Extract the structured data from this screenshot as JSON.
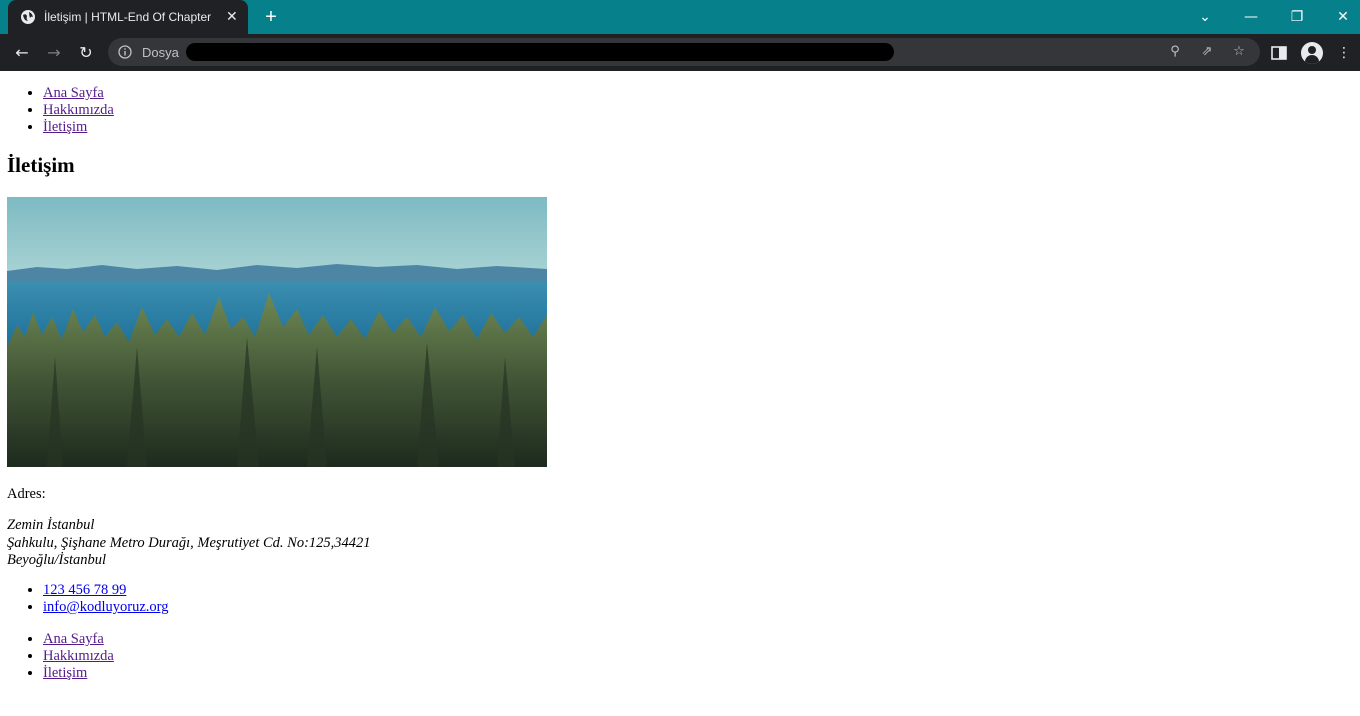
{
  "browser": {
    "tab_title": "İletişim | HTML-End Of Chapter",
    "tab_close": "✕",
    "new_tab": "+",
    "window_controls": {
      "dropdown": "⌄",
      "minimize": "—",
      "restore": "❐",
      "close": "✕"
    },
    "nav": {
      "back": "←",
      "forward": "→",
      "reload": "↻"
    },
    "omnibox": {
      "scheme_label": "Dosya",
      "url": ""
    },
    "icons": [
      "globe-icon",
      "info-icon",
      "zoom-icon",
      "share-icon",
      "star-icon",
      "side-panel-icon",
      "profile-icon",
      "menu-icon"
    ]
  },
  "page": {
    "nav_top": [
      "Ana Sayfa",
      "Hakkımızda",
      "İletişim"
    ],
    "heading": "İletişim",
    "address_label": "Adres:",
    "address_lines": [
      "Zemin İstanbul",
      "Şahkulu, Şişhane Metro Durağı, Meşrutiyet Cd. No:125,34421",
      "Beyoğlu/İstanbul"
    ],
    "contacts": [
      "123 456 78 99",
      "info@kodluyoruz.org"
    ],
    "nav_bottom": [
      "Ana Sayfa",
      "Hakkımızda",
      "İletişim"
    ]
  },
  "colors": {
    "tab_strip": "#06808a",
    "toolbar": "#202124",
    "visited_link": "#551a8b",
    "link": "#0000ee"
  }
}
